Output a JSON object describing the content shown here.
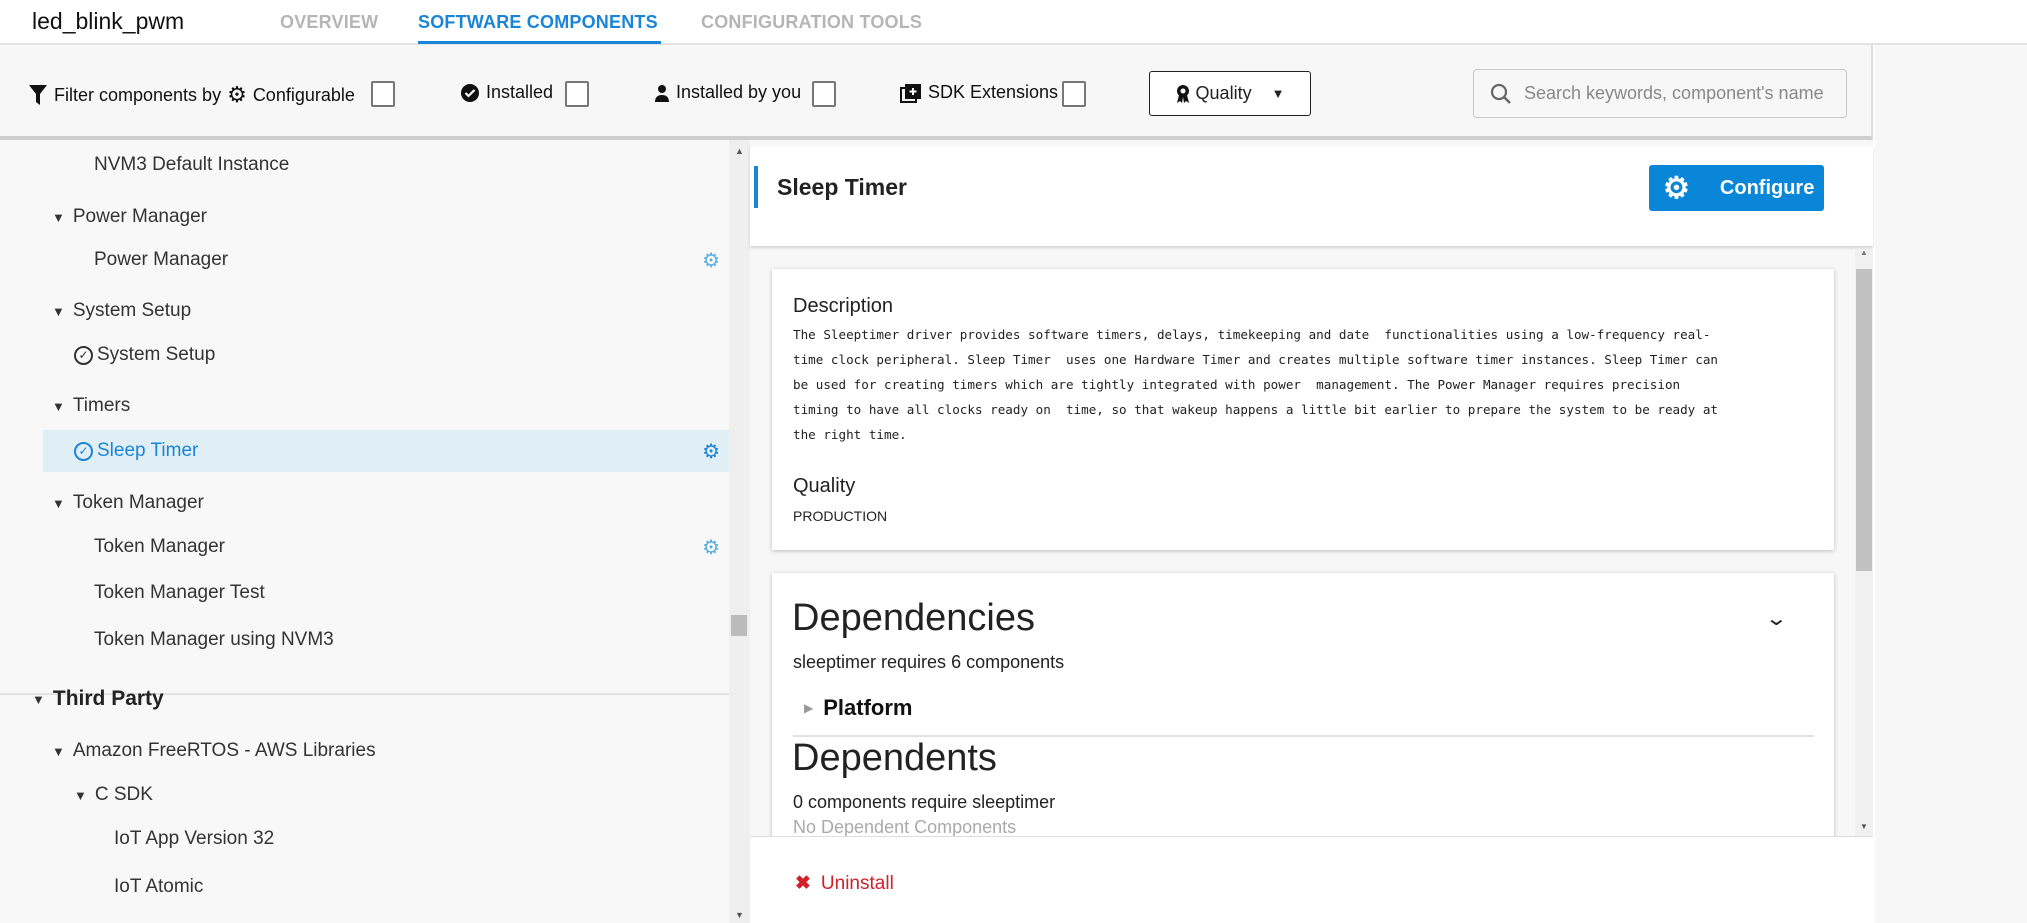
{
  "header": {
    "app_title": "led_blink_pwm",
    "tabs": [
      {
        "label": "OVERVIEW",
        "active": false
      },
      {
        "label": "SOFTWARE COMPONENTS",
        "active": true
      },
      {
        "label": "CONFIGURATION TOOLS",
        "active": false
      }
    ],
    "accent_color": "#1a85d6"
  },
  "filters": {
    "label": "Filter components by",
    "configurable": {
      "label": "Configurable",
      "checked": false
    },
    "installed": {
      "label": "Installed",
      "checked": false
    },
    "installed_by_you": {
      "label": "Installed by you",
      "checked": false
    },
    "sdk_extensions": {
      "label": "SDK Extensions",
      "checked": false
    },
    "quality_label": "Quality",
    "search_placeholder": "Search keywords, component's name"
  },
  "tree": [
    {
      "label": "NVM3 Default Instance",
      "type": "item",
      "level": 2
    },
    {
      "label": "Power Manager",
      "type": "group",
      "level": 1
    },
    {
      "label": "Power Manager",
      "type": "item",
      "level": 2,
      "configurable": true
    },
    {
      "label": "System Setup",
      "type": "group",
      "level": 1
    },
    {
      "label": "System Setup",
      "type": "item",
      "level": 2,
      "installed": true
    },
    {
      "label": "Timers",
      "type": "group",
      "level": 1
    },
    {
      "label": "Sleep Timer",
      "type": "item",
      "level": 2,
      "installed": true,
      "configurable": true,
      "selected": true
    },
    {
      "label": "Token Manager",
      "type": "group",
      "level": 1
    },
    {
      "label": "Token Manager",
      "type": "item",
      "level": 2,
      "configurable": true
    },
    {
      "label": "Token Manager Test",
      "type": "item",
      "level": 2
    },
    {
      "label": "Token Manager using NVM3",
      "type": "item",
      "level": 2
    },
    {
      "label": "Third Party",
      "type": "category",
      "level": 0
    },
    {
      "label": "Amazon FreeRTOS - AWS Libraries",
      "type": "group",
      "level": 1
    },
    {
      "label": "C SDK",
      "type": "group",
      "level": 2
    },
    {
      "label": "IoT App Version 32",
      "type": "item",
      "level": 3
    },
    {
      "label": "IoT Atomic",
      "type": "item",
      "level": 3
    }
  ],
  "component": {
    "title": "Sleep Timer",
    "configure_label": "Configure",
    "description_heading": "Description",
    "description": "The Sleeptimer driver provides software timers, delays, timekeeping and date  functionalities using a low-frequency real-\ntime clock peripheral. Sleep Timer  uses one Hardware Timer and creates multiple software timer instances. Sleep Timer can\nbe used for creating timers which are tightly integrated with power  management. The Power Manager requires precision\ntiming to have all clocks ready on  time, so that wakeup happens a little bit earlier to prepare the system to be ready at\nthe right time.",
    "quality_heading": "Quality",
    "quality_value": "PRODUCTION",
    "dependencies_heading": "Dependencies",
    "dependencies_summary": "sleeptimer requires 6 components",
    "dependency_groups": [
      "Platform"
    ],
    "dependents_heading": "Dependents",
    "dependents_summary": "0 components require sleeptimer",
    "dependents_empty": "No Dependent Components",
    "uninstall_label": "Uninstall",
    "uninstall_color": "#d0212b"
  }
}
